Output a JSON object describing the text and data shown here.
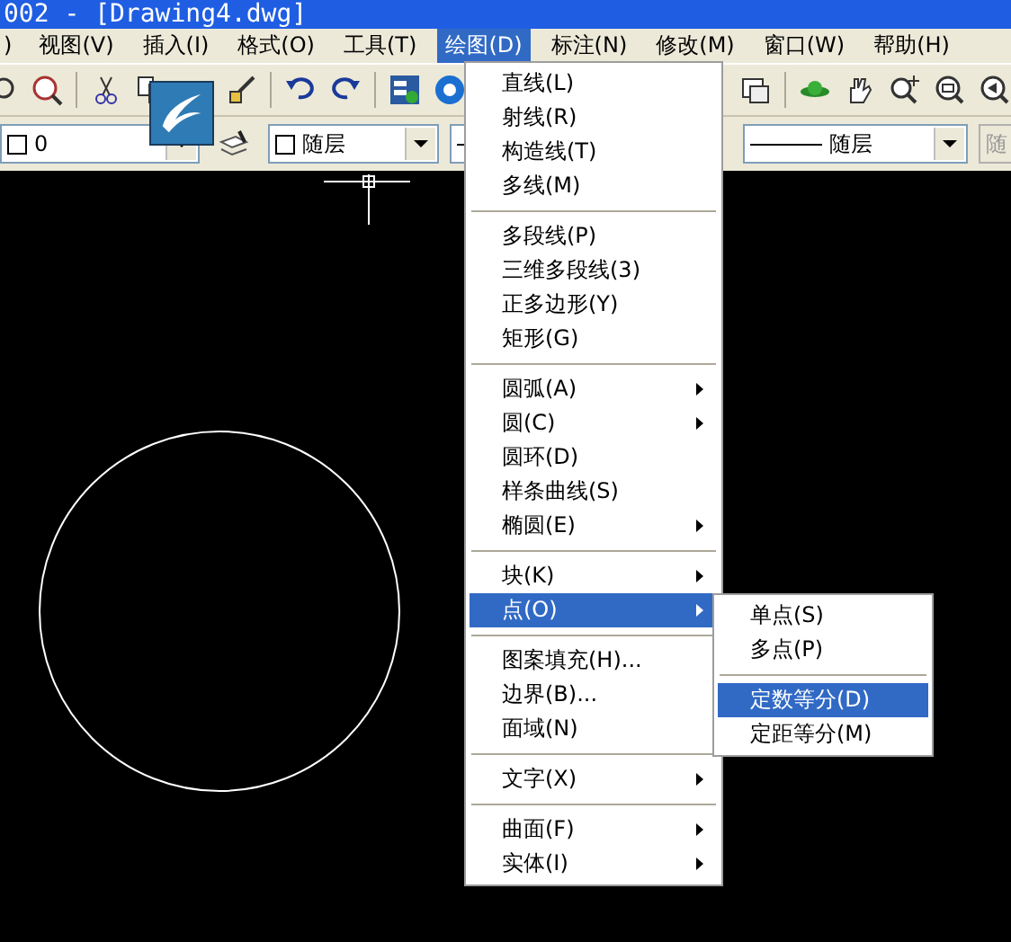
{
  "title_bar": {
    "title": "002 - [Drawing4.dwg]"
  },
  "menu_bar": [
    {
      "label": ")",
      "selected": false
    },
    {
      "label": "视图(V)",
      "selected": false
    },
    {
      "label": "插入(I)",
      "selected": false
    },
    {
      "label": "格式(O)",
      "selected": false
    },
    {
      "label": "工具(T)",
      "selected": false
    },
    {
      "label": "绘图(D)",
      "selected": true
    },
    {
      "label": "标注(N)",
      "selected": false
    },
    {
      "label": "修改(M)",
      "selected": false
    },
    {
      "label": "窗口(W)",
      "selected": false
    },
    {
      "label": "帮助(H)",
      "selected": false
    }
  ],
  "properties_bar": {
    "layer": "0",
    "color_setting": "随层",
    "lineweight": "随层",
    "plot_style": "随"
  },
  "draw_menu": [
    {
      "kind": "item",
      "label": "直线(L)",
      "submenu": false,
      "selected": false
    },
    {
      "kind": "item",
      "label": "射线(R)",
      "submenu": false,
      "selected": false
    },
    {
      "kind": "item",
      "label": "构造线(T)",
      "submenu": false,
      "selected": false
    },
    {
      "kind": "item",
      "label": "多线(M)",
      "submenu": false,
      "selected": false
    },
    {
      "kind": "separator"
    },
    {
      "kind": "item",
      "label": "多段线(P)",
      "submenu": false,
      "selected": false
    },
    {
      "kind": "item",
      "label": "三维多段线(3)",
      "submenu": false,
      "selected": false
    },
    {
      "kind": "item",
      "label": "正多边形(Y)",
      "submenu": false,
      "selected": false
    },
    {
      "kind": "item",
      "label": "矩形(G)",
      "submenu": false,
      "selected": false
    },
    {
      "kind": "separator"
    },
    {
      "kind": "item",
      "label": "圆弧(A)",
      "submenu": true,
      "selected": false
    },
    {
      "kind": "item",
      "label": "圆(C)",
      "submenu": true,
      "selected": false
    },
    {
      "kind": "item",
      "label": "圆环(D)",
      "submenu": false,
      "selected": false
    },
    {
      "kind": "item",
      "label": "样条曲线(S)",
      "submenu": false,
      "selected": false
    },
    {
      "kind": "item",
      "label": "椭圆(E)",
      "submenu": true,
      "selected": false
    },
    {
      "kind": "separator"
    },
    {
      "kind": "item",
      "label": "块(K)",
      "submenu": true,
      "selected": false
    },
    {
      "kind": "item",
      "label": "点(O)",
      "submenu": true,
      "selected": true
    },
    {
      "kind": "separator"
    },
    {
      "kind": "item",
      "label": "图案填充(H)...",
      "submenu": false,
      "selected": false
    },
    {
      "kind": "item",
      "label": "边界(B)...",
      "submenu": false,
      "selected": false
    },
    {
      "kind": "item",
      "label": "面域(N)",
      "submenu": false,
      "selected": false
    },
    {
      "kind": "separator"
    },
    {
      "kind": "item",
      "label": "文字(X)",
      "submenu": true,
      "selected": false
    },
    {
      "kind": "separator"
    },
    {
      "kind": "item",
      "label": "曲面(F)",
      "submenu": true,
      "selected": false
    },
    {
      "kind": "item",
      "label": "实体(I)",
      "submenu": true,
      "selected": false
    }
  ],
  "point_submenu": [
    {
      "kind": "item",
      "label": "单点(S)",
      "selected": false
    },
    {
      "kind": "item",
      "label": "多点(P)",
      "selected": false
    },
    {
      "kind": "separator"
    },
    {
      "kind": "item",
      "label": "定数等分(D)",
      "selected": true
    },
    {
      "kind": "item",
      "label": "定距等分(M)",
      "selected": false
    }
  ]
}
